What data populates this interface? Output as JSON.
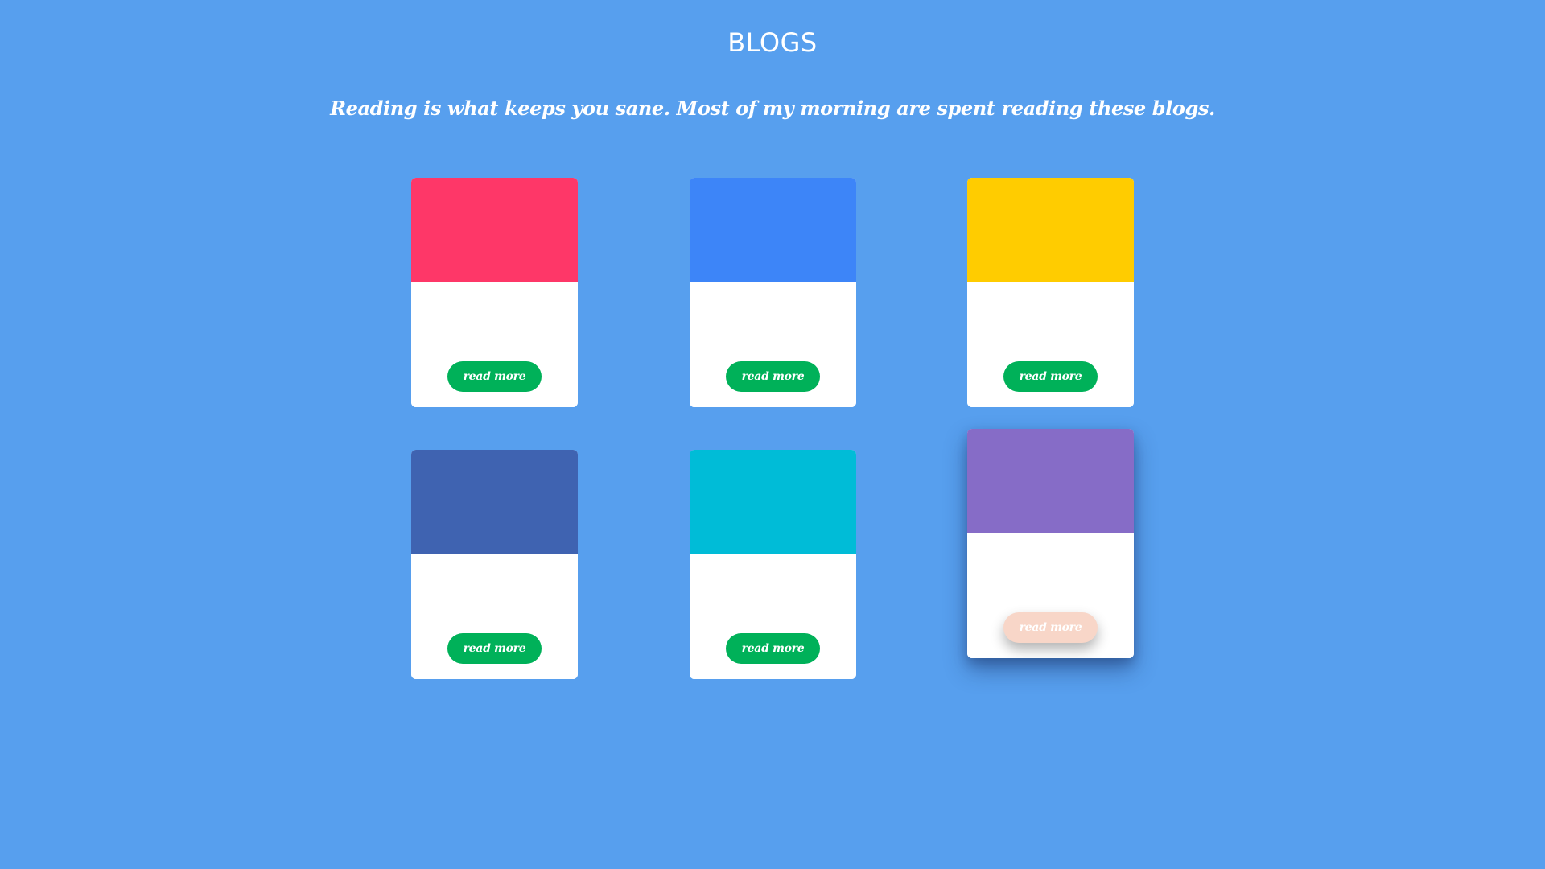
{
  "page": {
    "title": "BLOGS",
    "subtitle": "Reading is what keeps you sane. Most of my morning are spent reading these blogs."
  },
  "colors": {
    "background": "#579fee",
    "button": "#00b159",
    "button_hover": "#f8d6c8"
  },
  "cards": [
    {
      "color": "#fe3768",
      "button_label": "read more",
      "state": "default"
    },
    {
      "color": "#3d85f8",
      "button_label": "read more",
      "state": "default"
    },
    {
      "color": "#ffcc00",
      "button_label": "read more",
      "state": "default"
    },
    {
      "color": "#3f63b1",
      "button_label": "read more",
      "state": "default"
    },
    {
      "color": "#00bcd7",
      "button_label": "read more",
      "state": "default"
    },
    {
      "color": "#866cc7",
      "button_label": "read more",
      "state": "hovered"
    }
  ]
}
